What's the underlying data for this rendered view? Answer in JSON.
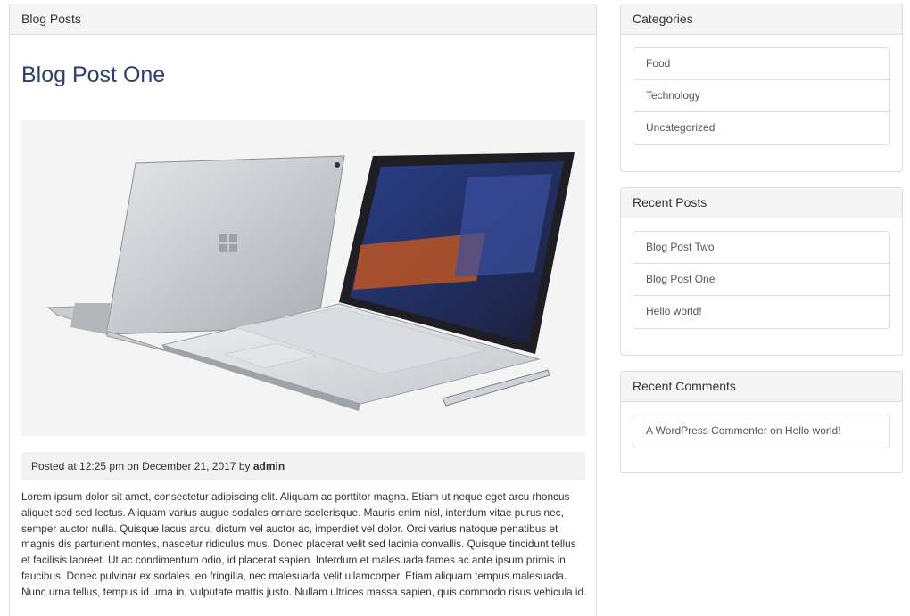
{
  "main": {
    "heading": "Blog Posts",
    "post": {
      "title": "Blog Post One",
      "meta_prefix": "Posted at 12:25 pm on December 21, 2017 by",
      "author": "admin",
      "body": "Lorem ipsum dolor sit amet, consectetur adipiscing elit. Aliquam ac porttitor magna. Etiam ut neque eget arcu rhoncus aliquet sed sed lectus. Aliquam varius augue sodales ornare scelerisque. Mauris enim nisl, interdum vitae purus nec, semper auctor nulla. Quisque lacus arcu, dictum vel auctor ac, imperdiet vel dolor. Orci varius natoque penatibus et magnis dis parturient montes, nascetur ridiculus mus. Donec placerat velit sed lacinia convallis. Quisque tincidunt tellus et facilisis laoreet. Ut ac condimentum odio, id placerat sapien. Interdum et malesuada fames ac ante ipsum primis in faucibus. Donec pulvinar ex sodales leo fringilla, nec malesuada velit ullamcorper. Etiam aliquam tempus malesuada. Nunc urna tellus, tempus id urna in, vulputate mattis justo. Nullam ultrices massa sapien, quis commodo risus vehicula id."
    }
  },
  "sidebar": {
    "categories": {
      "heading": "Categories",
      "items": [
        "Food",
        "Technology",
        "Uncategorized"
      ]
    },
    "recent_posts": {
      "heading": "Recent Posts",
      "items": [
        "Blog Post Two",
        "Blog Post One",
        "Hello world!"
      ]
    },
    "recent_comments": {
      "heading": "Recent Comments",
      "author": "A WordPress Commenter",
      "on": "on",
      "post": "Hello world!"
    }
  },
  "colors": {
    "title": "#2c3e70",
    "panel_border": "#dddddd",
    "heading_bg": "#f5f5f5"
  },
  "image": {
    "subject": "laptop-image"
  }
}
